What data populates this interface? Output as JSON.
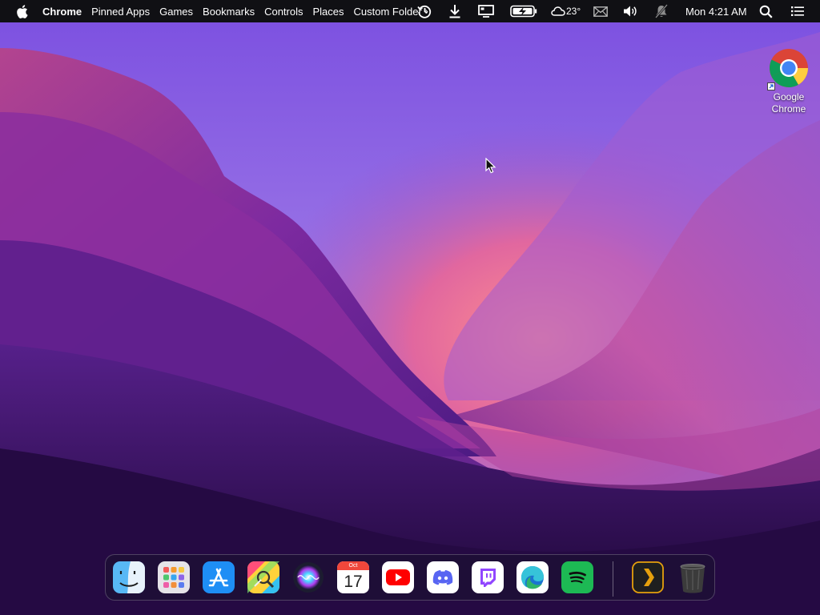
{
  "menubar": {
    "app_name": "Chrome",
    "menus": [
      "Pinned Apps",
      "Games",
      "Bookmarks",
      "Controls",
      "Places",
      "Custom Folder"
    ],
    "overflow_glyph": "›",
    "weather_temp": "23°",
    "clock": "Mon 4:21 AM",
    "icons": [
      "apple-icon",
      "history-icon",
      "download-icon",
      "display-icon",
      "battery-charging-icon",
      "cloud-icon",
      "mail-icon",
      "volume-icon",
      "notifications-off-icon",
      "search-icon",
      "control-center-icon"
    ]
  },
  "desktop": {
    "icons": [
      {
        "label": "Google Chrome",
        "icon": "chrome-icon"
      }
    ]
  },
  "dock": {
    "apps": [
      "Finder",
      "Launchpad",
      "App Store",
      "System Utilities",
      "Siri",
      "Calendar",
      "YouTube",
      "Discord",
      "Twitch",
      "Microsoft Edge",
      "Spotify",
      "Plex",
      "Trash"
    ],
    "calendar": {
      "month": "Oct",
      "day": "17"
    }
  },
  "colors": {
    "menubar": "#101014",
    "wallpaper_top": "#7a4fdb",
    "wallpaper_pink": "#f07a98",
    "wallpaper_bottom": "#21093d"
  }
}
